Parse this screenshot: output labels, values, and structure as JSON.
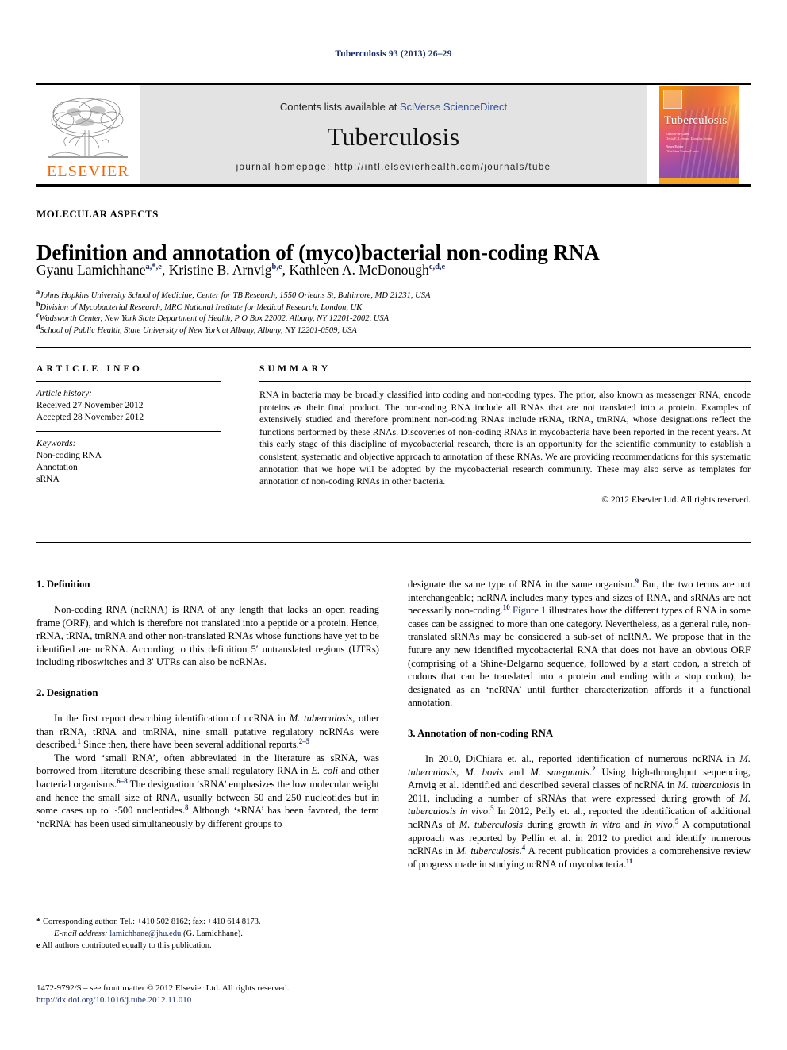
{
  "running_head": "Tuberculosis 93 (2013) 26–29",
  "masthead": {
    "publisher_name": "ELSEVIER",
    "contents_prefix": "Contents lists available at ",
    "contents_link": "SciVerse ScienceDirect",
    "journal_name": "Tuberculosis",
    "homepage": "journal homepage: http://intl.elsevierhealth.com/journals/tube",
    "cover_title": "Tuberculosis",
    "cover_editors_label": "Editors-in-Chief",
    "cover_editors": "Delia E. Lejeune\nDouglas Young",
    "cover_news_label": "News Editor",
    "cover_news": "Ghislaine Foster-Lewis"
  },
  "article": {
    "section_label": "MOLECULAR ASPECTS",
    "title": "Definition and annotation of (myco)bacterial non-coding RNA",
    "authors": [
      {
        "name": "Gyanu Lamichhane",
        "sup": "a,*,e"
      },
      {
        "name": "Kristine B. Arnvig",
        "sup": "b,e"
      },
      {
        "name": "Kathleen A. McDonough",
        "sup": "c,d,e"
      }
    ],
    "affiliations": [
      {
        "mark": "a",
        "text": "Johns Hopkins University School of Medicine, Center for TB Research, 1550 Orleans St, Baltimore, MD 21231, USA"
      },
      {
        "mark": "b",
        "text": "Division of Mycobacterial Research, MRC National Institute for Medical Research, London, UK"
      },
      {
        "mark": "c",
        "text": "Wadsworth Center, New York State Department of Health, P O Box 22002, Albany, NY 12201-2002, USA"
      },
      {
        "mark": "d",
        "text": "School of Public Health, State University of New York at Albany, Albany, NY 12201-0509, USA"
      }
    ]
  },
  "article_info": {
    "heading": "ARTICLE INFO",
    "history_label": "Article history:",
    "history": [
      "Received 27 November 2012",
      "Accepted 28 November 2012"
    ],
    "keywords_label": "Keywords:",
    "keywords": [
      "Non-coding RNA",
      "Annotation",
      "sRNA"
    ]
  },
  "summary": {
    "heading": "SUMMARY",
    "text": "RNA in bacteria may be broadly classified into coding and non-coding types. The prior, also known as messenger RNA, encode proteins as their final product. The non-coding RNA include all RNAs that are not translated into a protein. Examples of extensively studied and therefore prominent non-coding RNAs include rRNA, tRNA, tmRNA, whose designations reflect the functions performed by these RNAs. Discoveries of non-coding RNAs in mycobacteria have been reported in the recent years. At this early stage of this discipline of mycobacterial research, there is an opportunity for the scientific community to establish a consistent, systematic and objective approach to annotation of these RNAs. We are providing recommendations for this systematic annotation that we hope will be adopted by the mycobacterial research community. These may also serve as templates for annotation of non-coding RNAs in other bacteria.",
    "copyright": "© 2012 Elsevier Ltd. All rights reserved."
  },
  "body": {
    "section1_heading": "1. Definition",
    "section1_p1": "Non-coding RNA (ncRNA) is RNA of any length that lacks an open reading frame (ORF), and which is therefore not translated into a peptide or a protein. Hence, rRNA, tRNA, tmRNA and other non-translated RNAs whose functions have yet to be identified are ncRNA. According to this definition 5′ untranslated regions (UTRs) including riboswitches and 3′ UTRs can also be ncRNAs.",
    "section2_heading": "2. Designation",
    "section2_p1_a": "In the first report describing identification of ncRNA in ",
    "section2_p1_i": "M. tuberculosis",
    "section2_p1_b": ", other than rRNA, tRNA and tmRNA, nine small putative regulatory ncRNAs were described.",
    "section2_p1_ref1": "1",
    "section2_p1_c": " Since then, there have been several additional reports.",
    "section2_p1_ref2": "2–5",
    "section2_p2_a": "The word ‘small RNA’, often abbreviated in the literature as sRNA, was borrowed from literature describing these small regulatory RNA in ",
    "section2_p2_i": "E. coli",
    "section2_p2_b": " and other bacterial organisms.",
    "section2_p2_ref1": "6–8",
    "section2_p2_c": " The designation ‘sRNA’ emphasizes the low molecular weight and hence the small size of RNA, usually between 50 and 250 nucleotides but in some cases up to ~500 nucleotides.",
    "section2_p2_ref2": "8",
    "section2_p2_d": " Although ‘sRNA’ has been favored, the term ‘ncRNA’ has been used simultaneously by different groups to",
    "right_p1_a": "designate the same type of RNA in the same organism.",
    "right_p1_ref1": "9",
    "right_p1_b": " But, the two terms are not interchangeable; ncRNA includes many types and sizes of RNA, and sRNAs are not necessarily non-coding.",
    "right_p1_ref2": "10",
    "right_p1_figlink": " Figure 1",
    "right_p1_c": " illustrates how the different types of RNA in some cases can be assigned to more than one category. Nevertheless, as a general rule, non-translated sRNAs may be considered a sub-set of ncRNA. We propose that in the future any new identified mycobacterial RNA that does not have an obvious ORF (comprising of a Shine-Delgarno sequence, followed by a start codon, a stretch of codons that can be translated into a protein and ending with a stop codon), be designated as an ‘ncRNA’ until further characterization affords it a functional annotation.",
    "section3_heading": "3. Annotation of non-coding RNA",
    "section3_a": "In 2010, DiChiara et. al., reported identification of numerous ncRNA in ",
    "section3_i1": "M. tuberculosis",
    "section3_b": ", ",
    "section3_i2": "M. bovis",
    "section3_c": " and ",
    "section3_i3": "M. smegmatis",
    "section3_d": ".",
    "section3_ref1": "2",
    "section3_e": " Using high-throughput sequencing, Arnvig et al. identified and described several classes of ncRNA in ",
    "section3_i4": "M. tuberculosis",
    "section3_f": " in 2011, including a number of sRNAs that were expressed during growth of ",
    "section3_i5": "M. tuberculosis in vivo",
    "section3_g": ".",
    "section3_ref2": "5",
    "section3_h": " In 2012, Pelly et. al., reported the identification of additional ncRNAs of ",
    "section3_i6": "M. tuberculosis",
    "section3_j": " during growth ",
    "section3_i7": "in vitro",
    "section3_k": " and ",
    "section3_i8": "in vivo",
    "section3_l": ".",
    "section3_ref3": "5",
    "section3_m": " A computational approach was reported by Pellin et al. in 2012 to predict and identify numerous ncRNAs in ",
    "section3_i9": "M. tuberculosis",
    "section3_n": ".",
    "section3_ref4": "4",
    "section3_o": " A recent publication provides a comprehensive review of progress made in studying ncRNA of mycobacteria.",
    "section3_ref5": "11"
  },
  "footnotes": {
    "corresponding_mark": "*",
    "corresponding_text": "Corresponding author. Tel.: +410 502 8162; fax: +410 614 8173.",
    "email_label": "E-mail address:",
    "email": "lamichhane@jhu.edu",
    "email_suffix": "(G. Lamichhane).",
    "equal_mark": "e",
    "equal_text": "All authors contributed equally to this publication."
  },
  "imprint": {
    "line1": "1472-9792/$ – see front matter © 2012 Elsevier Ltd. All rights reserved.",
    "doi": "http://dx.doi.org/10.1016/j.tube.2012.11.010"
  },
  "colors": {
    "elsevier_orange": "#ec6608",
    "link_blue": "#1a2c6b",
    "sciencedirect_blue": "#2b4fa0",
    "masthead_grey": "#e3e3e3"
  }
}
